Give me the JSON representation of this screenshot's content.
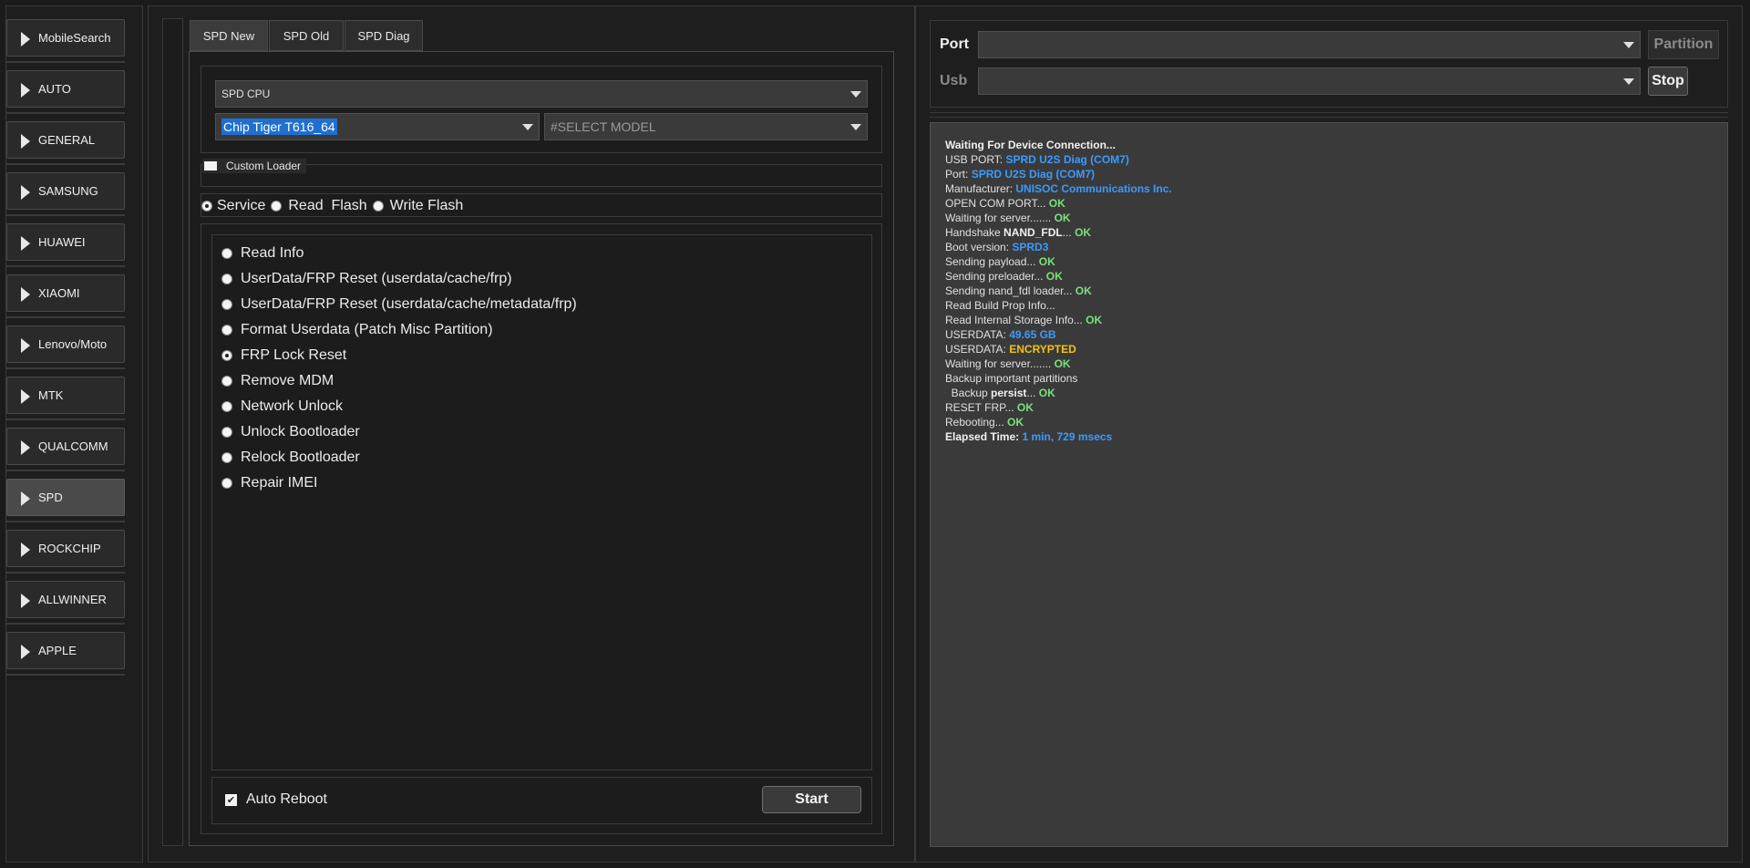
{
  "sidebar": {
    "items": [
      {
        "label": "MobileSearch",
        "active": false
      },
      {
        "label": "AUTO",
        "active": false
      },
      {
        "label": "GENERAL",
        "active": false
      },
      {
        "label": "SAMSUNG",
        "active": false
      },
      {
        "label": "HUAWEI",
        "active": false
      },
      {
        "label": "XIAOMI",
        "active": false
      },
      {
        "label": "Lenovo/Moto",
        "active": false
      },
      {
        "label": "MTK",
        "active": false
      },
      {
        "label": "QUALCOMM",
        "active": false
      },
      {
        "label": "SPD",
        "active": true
      },
      {
        "label": "ROCKCHIP",
        "active": false
      },
      {
        "label": "ALLWINNER",
        "active": false
      },
      {
        "label": "APPLE",
        "active": false
      }
    ]
  },
  "tabs": [
    "SPD New",
    "SPD Old",
    "SPD Diag"
  ],
  "active_tab": "SPD New",
  "cpu_combo": "SPD CPU",
  "chip_combo": "Chip Tiger T616_64",
  "model_combo": "#SELECT MODEL",
  "custom_loader_label": "Custom Loader",
  "mode": {
    "service": "Service",
    "read_flash": "Read  Flash",
    "write_flash": "Write Flash",
    "selected": "Service"
  },
  "options": [
    "Read Info",
    "UserData/FRP Reset (userdata/cache/frp)",
    "UserData/FRP Reset (userdata/cache/metadata/frp)",
    "Format Userdata (Patch Misc Partition)",
    "FRP Lock Reset",
    "Remove MDM",
    "Network Unlock",
    "Unlock Bootloader",
    "Relock Bootloader",
    "Repair IMEI"
  ],
  "selected_option": "FRP Lock Reset",
  "auto_reboot_label": "Auto Reboot",
  "auto_reboot_checked": true,
  "start_label": "Start",
  "port_label": "Port",
  "usb_label": "Usb",
  "partition_label": "Partition",
  "stop_label": "Stop",
  "log": {
    "l0": "Waiting For Device Connection...",
    "l1a": "USB PORT: ",
    "l1b": "SPRD U2S Diag (COM7)",
    "l2a": "Port: ",
    "l2b": "SPRD U2S Diag (COM7)",
    "l3a": "Manufacturer: ",
    "l3b": "UNISOC Communications Inc.",
    "l4a": "OPEN COM PORT... ",
    "l4b": "OK",
    "l5a": "Waiting for server....... ",
    "l5b": "OK",
    "l6a": "Handshake ",
    "l6b": "NAND_FDL",
    "l6c": "... ",
    "l6d": "OK",
    "l7a": "Boot version: ",
    "l7b": "SPRD3",
    "l8a": "Sending payload... ",
    "l8b": "OK",
    "l9a": "Sending preloader... ",
    "l9b": "OK",
    "l10a": "Sending nand_fdl loader... ",
    "l10b": "OK",
    "l11": "Read Build Prop Info...",
    "l12a": "Read Internal Storage Info... ",
    "l12b": "OK",
    "l13a": "USERDATA: ",
    "l13b": "49.65 GB",
    "l14a": "USERDATA: ",
    "l14b": "ENCRYPTED",
    "l15a": "Waiting for server....... ",
    "l15b": "OK",
    "l16": "Backup important partitions",
    "l17a": "  Backup ",
    "l17b": "persist",
    "l17c": "... ",
    "l17d": "OK",
    "l18a": "RESET FRP... ",
    "l18b": "OK",
    "l19a": "Rebooting... ",
    "l19b": "OK",
    "l20a": "Elapsed Time: ",
    "l20b": "1 min, 729 msecs"
  },
  "colors": {
    "ok": "#7be07b",
    "info": "#3a9bff",
    "warn": "#f1c21b",
    "bg": "#1b1b1b"
  }
}
